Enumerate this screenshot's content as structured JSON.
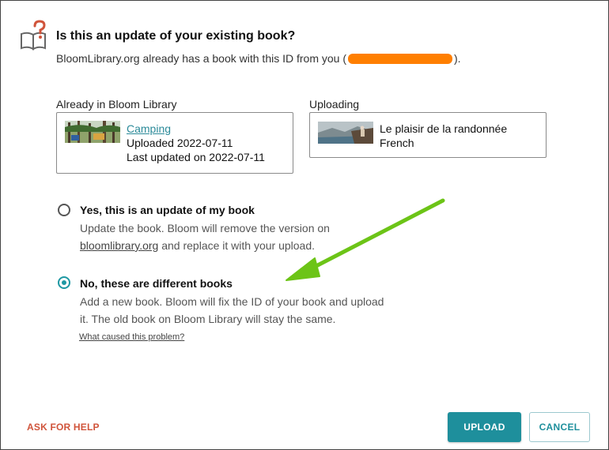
{
  "dialog": {
    "title": "Is this an update of your existing book?",
    "subtitle_prefix": "BloomLibrary.org already has a book with this ID from you (",
    "subtitle_suffix": ")."
  },
  "existing": {
    "label": "Already in Bloom Library",
    "book_title": "Camping",
    "uploaded": "Uploaded 2022-07-11",
    "last_updated": "Last updated on 2022-07-11"
  },
  "uploading": {
    "label": "Uploading",
    "book_title": "Le plaisir de la randonnée",
    "language": "French"
  },
  "options": [
    {
      "title": "Yes, this is an update of my book",
      "desc_1": "Update the book. Bloom will remove the version on",
      "desc_link": "bloomlibrary.org",
      "desc_2": " and replace it with your upload.",
      "selected": false
    },
    {
      "title": "No, these are different books",
      "desc_line1": "Add a new book. Bloom will fix the ID of your book and upload",
      "desc_line2": "it. The old book on Bloom Library will stay the same.",
      "selected": true
    }
  ],
  "cause_link": "What caused this problem?",
  "footer": {
    "ask_help": "ASK FOR HELP",
    "upload": "UPLOAD",
    "cancel": "CANCEL"
  },
  "colors": {
    "accent": "#1e8f9c",
    "help": "#d0543b",
    "redaction": "#ff7f00",
    "arrow": "#6cc417"
  }
}
